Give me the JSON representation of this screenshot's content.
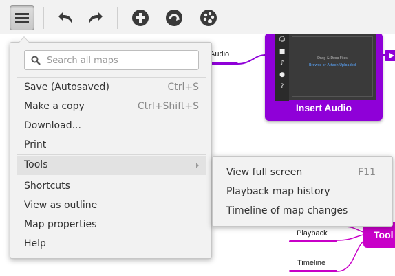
{
  "toolbar": {
    "menu_icon": "hamburger-icon",
    "undo_icon": "undo-icon",
    "redo_icon": "redo-icon",
    "add_icon": "plus-circle-icon",
    "refresh_icon": "refresh-circle-icon",
    "theme_icon": "palette-icon",
    "icon_color": "#3a3a3a"
  },
  "canvas": {
    "audio_label": "Audio",
    "insert_audio_title": "Insert Audio",
    "drop_text": "Drag & Drop Files",
    "drop_links": "Browse or Attach Uploaded",
    "tools_node_label": "Tool",
    "playback_label": "Playback",
    "timeline_label": "Timeline",
    "node_color": "#8f00d8",
    "tools_color": "#c800c8"
  },
  "menu": {
    "search": {
      "placeholder": "Search all maps",
      "value": ""
    },
    "items": [
      {
        "label": "Save (Autosaved)",
        "shortcut": "Ctrl+S"
      },
      {
        "label": "Make a copy",
        "shortcut": "Ctrl+Shift+S"
      },
      {
        "label": "Download...",
        "shortcut": ""
      },
      {
        "label": "Print",
        "shortcut": ""
      },
      {
        "label": "Tools",
        "shortcut": ""
      },
      {
        "label": "Shortcuts",
        "shortcut": ""
      },
      {
        "label": "View as outline",
        "shortcut": ""
      },
      {
        "label": "Map properties",
        "shortcut": ""
      },
      {
        "label": "Help",
        "shortcut": ""
      }
    ]
  },
  "submenu": {
    "items": [
      {
        "label": "View full screen",
        "shortcut": "F11"
      },
      {
        "label": "Playback map history",
        "shortcut": ""
      },
      {
        "label": "Timeline of map changes",
        "shortcut": ""
      }
    ]
  }
}
